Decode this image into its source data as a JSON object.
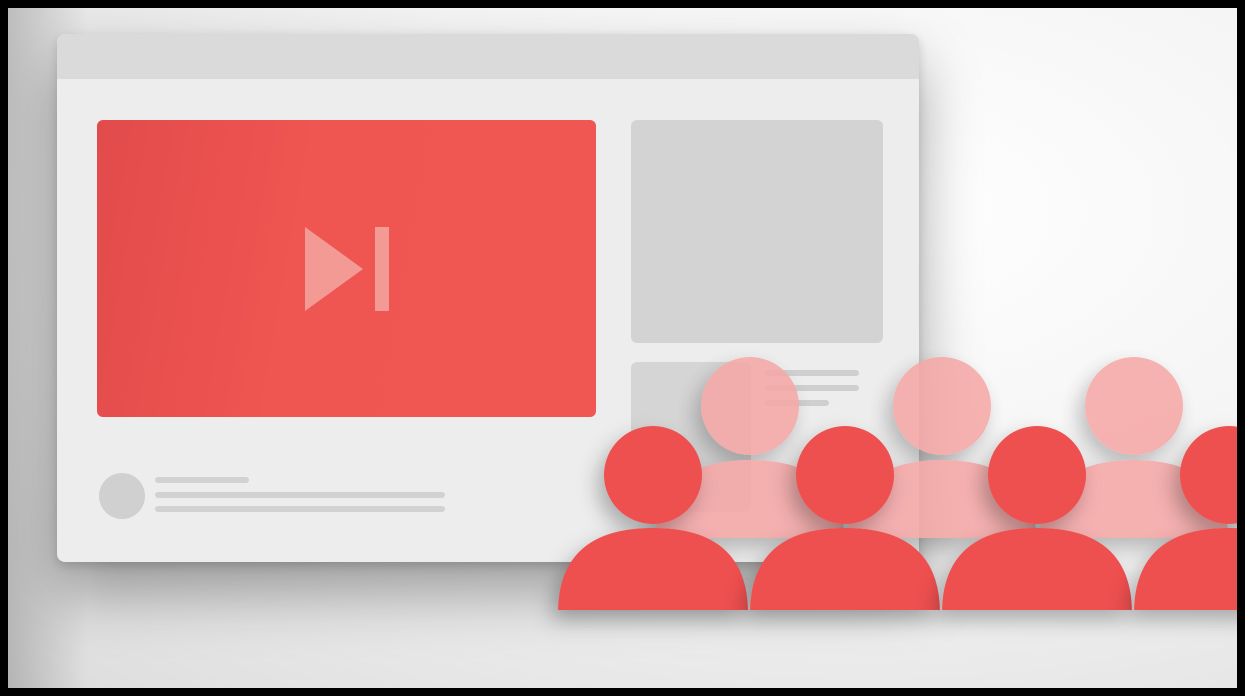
{
  "illustration": {
    "player": {
      "icon": "skip-forward-icon",
      "color": "#ef5551"
    },
    "audience": {
      "icon": "person-icon",
      "front_row_color": "#ee4f4f",
      "back_row_color": "#f6a5a5",
      "front_row_count": 4,
      "back_row_count": 3
    }
  }
}
